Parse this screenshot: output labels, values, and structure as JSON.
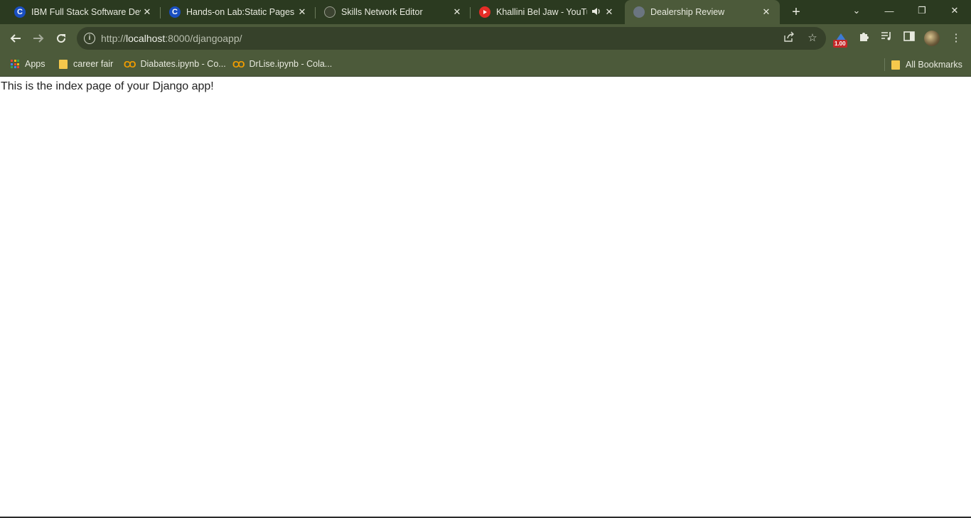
{
  "tabs": [
    {
      "title": "IBM Full Stack Software Developer",
      "favicon": "coursera-icon",
      "active": false
    },
    {
      "title": "Hands-on Lab:Static Pages | Skills",
      "favicon": "coursera-icon",
      "active": false
    },
    {
      "title": "Skills Network Editor",
      "favicon": "skills-network-icon",
      "active": false
    },
    {
      "title": "Khallini Bel Jaw - YouTube",
      "favicon": "youtube-icon",
      "active": false,
      "audio": true
    },
    {
      "title": "Dealership Review",
      "favicon": "globe-icon",
      "active": true
    }
  ],
  "window_controls": {
    "tab_search": "⌄",
    "minimize": "—",
    "restore": "❐",
    "close": "✕"
  },
  "address": {
    "prefix": "http://",
    "host": "localhost",
    "rest": ":8000/djangoapp/"
  },
  "extensions": {
    "badge_value": "1.00"
  },
  "bookmarks": [
    {
      "label": "Apps",
      "icon": "apps-grid-icon"
    },
    {
      "label": "career fair",
      "icon": "folder-icon"
    },
    {
      "label": "Diabates.ipynb - Co...",
      "icon": "colab-icon"
    },
    {
      "label": "DrLise.ipynb - Cola...",
      "icon": "colab-icon"
    }
  ],
  "all_bookmarks": {
    "label": "All Bookmarks"
  },
  "page": {
    "text": "This is the index page of your Django app!"
  },
  "colors": {
    "titlebar": "#2b3a20",
    "toolbar": "#4c5a3a",
    "omnibox": "#36412a"
  }
}
